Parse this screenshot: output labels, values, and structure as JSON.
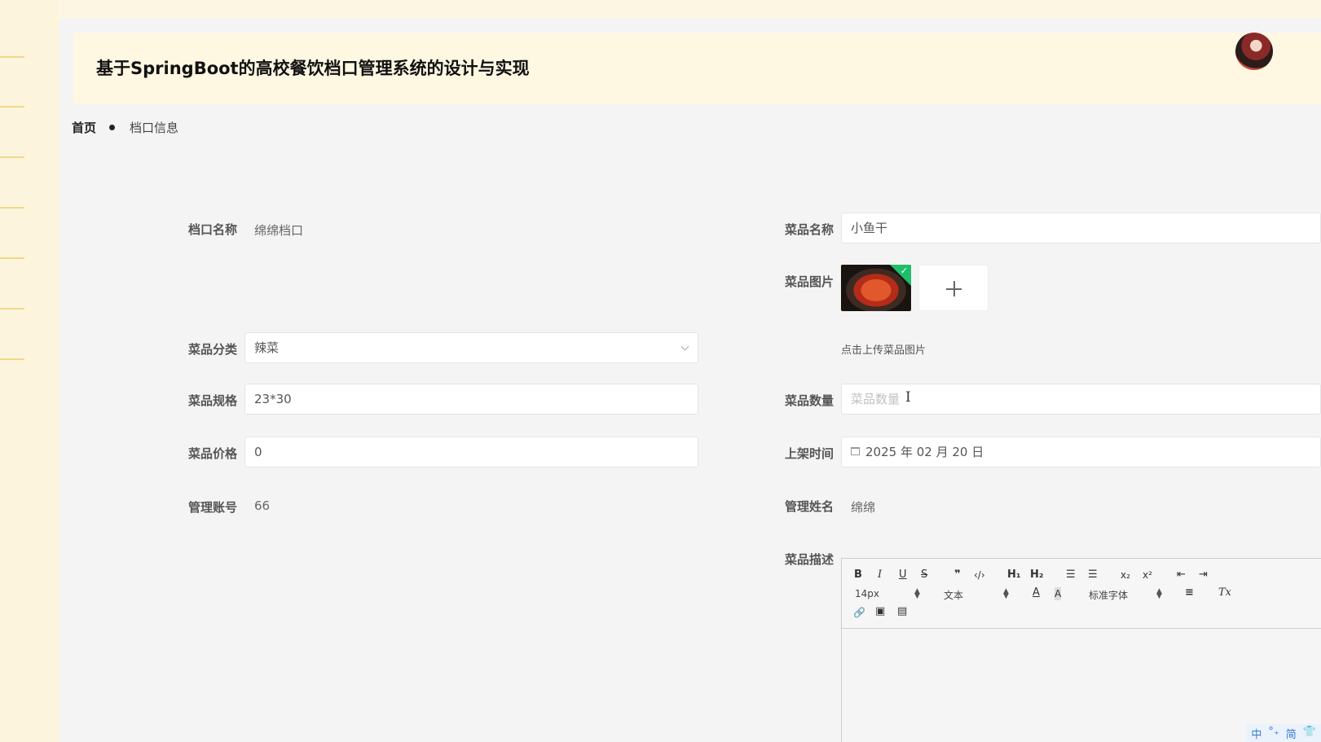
{
  "header": {
    "title": "基于SpringBoot的高校餐饮档口管理系统的设计与实现"
  },
  "breadcrumb": {
    "home": "首页",
    "current": "档口信息"
  },
  "form": {
    "stall_name": {
      "label": "档口名称",
      "value": "绵绵档口"
    },
    "dish_category": {
      "label": "菜品分类",
      "value": "辣菜"
    },
    "dish_spec": {
      "label": "菜品规格",
      "value": "23*30"
    },
    "dish_price": {
      "label": "菜品价格",
      "value": "0"
    },
    "manager_account": {
      "label": "管理账号",
      "value": "66"
    },
    "dish_name": {
      "label": "菜品名称",
      "value": "小鱼干"
    },
    "dish_image": {
      "label": "菜品图片",
      "hint": "点击上传菜品图片",
      "upload_icon": "plus-icon"
    },
    "dish_quantity": {
      "label": "菜品数量",
      "placeholder": "菜品数量"
    },
    "listing_time": {
      "label": "上架时间",
      "value": "2025 年 02 月 20 日",
      "icon": "calendar-icon"
    },
    "manager_name": {
      "label": "管理姓名",
      "value": "绵绵"
    },
    "dish_description": {
      "label": "菜品描述"
    }
  },
  "editor": {
    "toolbar": {
      "bold": "B",
      "italic": "I",
      "underline": "U",
      "strike": "S",
      "quote": "❞",
      "code": "‹/›",
      "h1": "H₁",
      "h2": "H₂",
      "ordered_list": "☰",
      "bullet_list": "☰",
      "subscript": "x₂",
      "superscript": "x²",
      "outdent": "⇤",
      "indent": "⇥",
      "font_size": "14px",
      "text_type": "文本",
      "font_family": "标准字体",
      "font_color": "A",
      "bg_color": "A",
      "align": "≡",
      "clear_format": "Tx",
      "link": "🔗",
      "image": "▣",
      "video": "▤"
    },
    "ime": [
      "中",
      "°₊",
      "简",
      "👕"
    ]
  },
  "colors": {
    "page_bg": "#fdf6e3",
    "header_bg": "#fef7e2",
    "panel_bg": "#f4f4f4",
    "thumb_check": "#1fbf6a"
  }
}
